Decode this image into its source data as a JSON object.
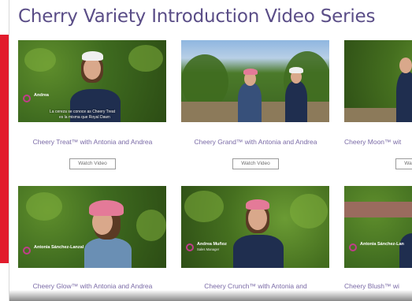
{
  "page": {
    "title": "Cherry Variety Introduction Video Series"
  },
  "watch_label": "Watch Video",
  "videos": [
    {
      "title": "Cheery Treat™ with Antonia and Andrea",
      "overlay_name": "Andrea",
      "overlay_role": "",
      "caption_line1": "La cereza se conoce as Cheery Treat",
      "caption_line2": "es la misma que Royal Dawn"
    },
    {
      "title": "Cheery Grand™ with Antonia and Andrea"
    },
    {
      "title": "Cheery Moon™ wit"
    },
    {
      "title": "Cheery Glow™ with Antonia and Andrea",
      "overlay_name": "Antonia Sánchez-Lanzal",
      "overlay_role": ""
    },
    {
      "title": "Cheery Crunch™ with Antonia and",
      "overlay_name": "Andrea Muñoz",
      "overlay_role": "Sales Manager"
    },
    {
      "title": "Cheery Blush™ wi",
      "overlay_name": "Antonia Sánchez-Lan"
    }
  ],
  "colors": {
    "title": "#5a4d87",
    "card_title": "#7a6aa6",
    "accent_strip": "#e21b2c",
    "logo": "#c13d8a"
  }
}
